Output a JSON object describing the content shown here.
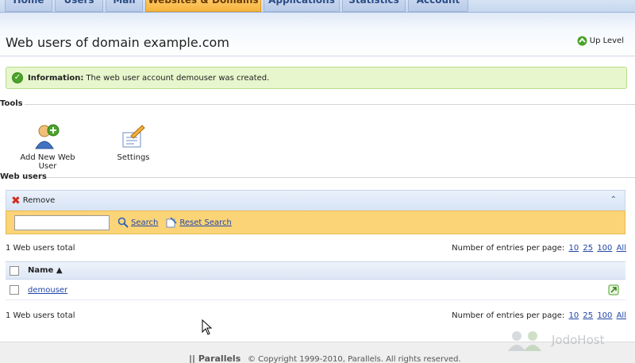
{
  "nav": {
    "tabs": [
      {
        "label": "Home"
      },
      {
        "label": "Users"
      },
      {
        "label": "Mail"
      },
      {
        "label": "Websites & Domains"
      },
      {
        "label": "Applications"
      },
      {
        "label": "Statistics"
      },
      {
        "label": "Account"
      }
    ],
    "active_tab": "Websites & Domains"
  },
  "header": {
    "title": "Web users of domain example.com",
    "up_level": "Up Level"
  },
  "info": {
    "label": "Information:",
    "message": "The web user account demouser was created."
  },
  "tools": {
    "section_title": "Tools",
    "add_user_label": "Add New Web User",
    "settings_label": "Settings"
  },
  "web_users": {
    "section_title": "Web users",
    "remove_label": "Remove",
    "search_placeholder": "",
    "search_label": "Search",
    "reset_search_label": "Reset Search",
    "total_text": "1 Web users total",
    "per_page_label": "Number of entries per page:",
    "per_page_options": [
      "10",
      "25",
      "100",
      "All"
    ],
    "column_name": "Name",
    "sort_indicator": "▲",
    "rows": [
      {
        "name": "demouser"
      }
    ]
  },
  "footer": {
    "brand_prefix": "||",
    "brand": "Parallels",
    "copyright": "© Copyright 1999-2010, Parallels. All rights reserved."
  },
  "watermark": "JodoHost",
  "colors": {
    "active_tab": "#f7b53d",
    "info_bg": "#e7f6cc",
    "search_bar_bg": "#fbd478",
    "link": "#2247a8"
  }
}
